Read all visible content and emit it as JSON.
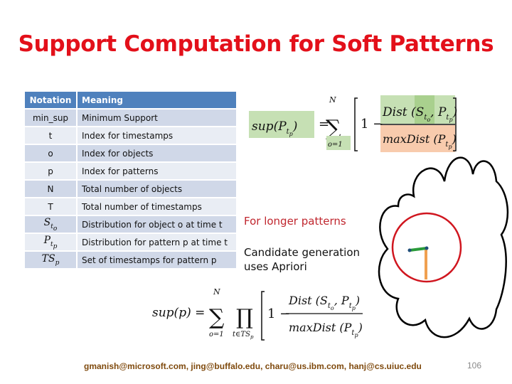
{
  "slide": {
    "title": "Support Computation for Soft Patterns",
    "footer": "gmanish@microsoft.com, jing@buffalo.edu, charu@us.ibm.com, hanj@cs.uiuc.edu",
    "page_number": "106"
  },
  "table": {
    "headers": [
      "Notation",
      "Meaning"
    ],
    "rows": [
      {
        "notation": "min_sup",
        "meaning": "Minimum Support"
      },
      {
        "notation": "t",
        "meaning": "Index for timestamps"
      },
      {
        "notation": "o",
        "meaning": "Index for objects"
      },
      {
        "notation": "p",
        "meaning": "Index for patterns"
      },
      {
        "notation": "N",
        "meaning": "Total number of objects"
      },
      {
        "notation": "T",
        "meaning": "Total number of timestamps"
      },
      {
        "notation": "S",
        "sub": "t",
        "subsub": "o",
        "meaning": "Distribution for object o at time t"
      },
      {
        "notation": "P",
        "sub": "t",
        "subsub": "p",
        "meaning": "Distribution for pattern p at time t"
      },
      {
        "notation": "TS",
        "sub": "p",
        "meaning": "Set of timestamps for pattern p"
      }
    ]
  },
  "formula_top": {
    "lhs": "sup",
    "sum_upper": "N",
    "sum_lower": "o=1",
    "one_minus": "1 −",
    "numerator_fn": "Dist",
    "denominator_fn": "maxDist"
  },
  "formula_bottom": {
    "lhs": "sup(p) =",
    "sum_upper": "N",
    "sum_lower": "o=1",
    "prod_lower": "t∈TS",
    "prod_lower_sub": "p",
    "one_minus": "1 −",
    "numerator_fn": "Dist",
    "denominator_fn": "maxDist"
  },
  "side": {
    "heading": "For longer patterns",
    "line1": "Candidate generation",
    "line2": "uses Apriori"
  },
  "colors": {
    "title": "#e3101a",
    "table_header": "#4f81bd",
    "highlight_green": "#c6e0b4",
    "highlight_orange": "#f8cbad",
    "circle": "#d0161f",
    "footer": "#7f4a0e"
  }
}
